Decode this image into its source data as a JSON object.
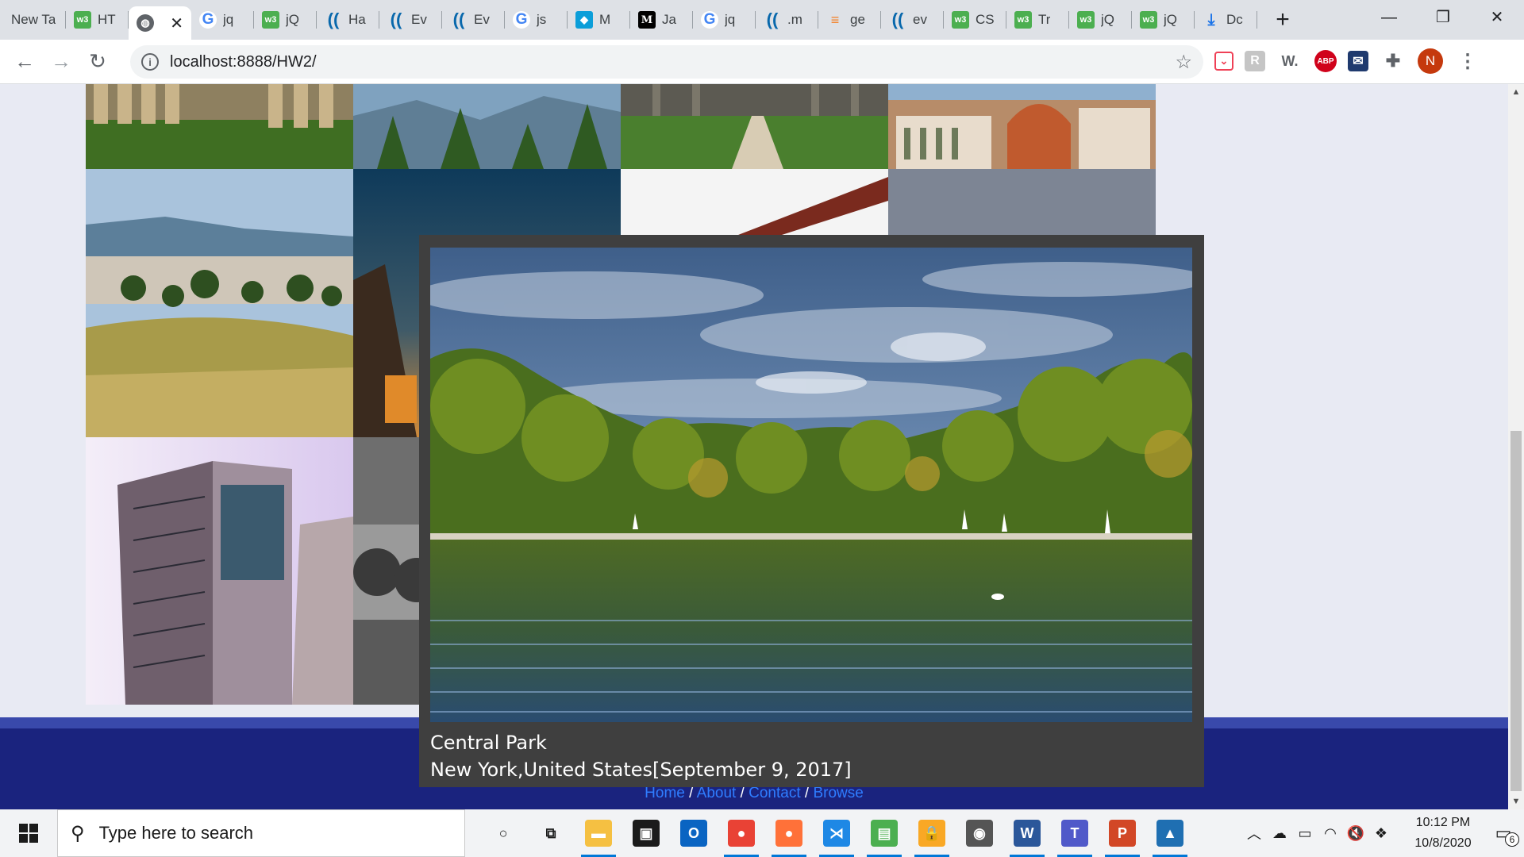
{
  "browser": {
    "tabs": [
      {
        "title": "New Ta",
        "icon": "none"
      },
      {
        "title": "HT",
        "icon": "w3schools-icon"
      },
      {
        "title": "",
        "icon": "globe-icon",
        "active": true
      },
      {
        "title": "jq",
        "icon": "google-icon"
      },
      {
        "title": "jQ",
        "icon": "w3schools-icon"
      },
      {
        "title": "Ha",
        "icon": "jquery-icon"
      },
      {
        "title": "Ev",
        "icon": "jquery-icon"
      },
      {
        "title": "Ev",
        "icon": "jquery-icon"
      },
      {
        "title": "js",
        "icon": "google-icon"
      },
      {
        "title": "M",
        "icon": "mortarboard-icon"
      },
      {
        "title": "Ja",
        "icon": "medium-icon"
      },
      {
        "title": "jq",
        "icon": "google-icon"
      },
      {
        "title": ".m",
        "icon": "jquery-icon"
      },
      {
        "title": "ge",
        "icon": "stackoverflow-icon"
      },
      {
        "title": "ev",
        "icon": "jquery-icon"
      },
      {
        "title": "CS",
        "icon": "w3schools-icon"
      },
      {
        "title": "Tr",
        "icon": "w3schools-icon"
      },
      {
        "title": "jQ",
        "icon": "w3schools-icon"
      },
      {
        "title": "jQ",
        "icon": "w3schools-icon"
      },
      {
        "title": "Dc",
        "icon": "download-icon"
      }
    ],
    "url": "localhost:8888/HW2/",
    "profile_initial": "N",
    "extensions": [
      "pocket-icon",
      "r-extension-icon",
      "w-extension-icon",
      "adblock-plus-icon",
      "mail-extension-icon",
      "extensions-puzzle-icon"
    ]
  },
  "page": {
    "footer_links": {
      "home": "Home",
      "about": "About",
      "contact": "Contact",
      "browse": "Browse",
      "separator": " / "
    }
  },
  "lightbox": {
    "title": "Central Park",
    "detail": "New York,United States[September 9, 2017]"
  },
  "taskbar": {
    "search_placeholder": "Type here to search",
    "time": "10:12 PM",
    "date": "10/8/2020",
    "notification_count": "6",
    "apps": [
      {
        "name": "cortana-icon",
        "glyph": "○",
        "color": "#1b1b1b"
      },
      {
        "name": "task-view-icon",
        "glyph": "⧉",
        "color": "#1b1b1b"
      },
      {
        "name": "file-explorer-icon",
        "glyph": "▬",
        "color": "#f5c042"
      },
      {
        "name": "store-icon",
        "glyph": "▣",
        "color": "#1b1b1b"
      },
      {
        "name": "outlook-icon",
        "glyph": "O",
        "color": "#0a64c2"
      },
      {
        "name": "chrome-icon",
        "glyph": "●",
        "color": "#e94235"
      },
      {
        "name": "firefox-icon",
        "glyph": "●",
        "color": "#ff7139"
      },
      {
        "name": "vscode-icon",
        "glyph": "⋊",
        "color": "#1e88e5"
      },
      {
        "name": "notepad-icon",
        "glyph": "▤",
        "color": "#4caf50"
      },
      {
        "name": "keepass-icon",
        "glyph": "🔒",
        "color": "#f9a825"
      },
      {
        "name": "github-icon",
        "glyph": "◉",
        "color": "#555"
      },
      {
        "name": "word-icon",
        "glyph": "W",
        "color": "#2b579a"
      },
      {
        "name": "teams-icon",
        "glyph": "T",
        "color": "#5059c9"
      },
      {
        "name": "powerpoint-icon",
        "glyph": "P",
        "color": "#d24726"
      },
      {
        "name": "photos-icon",
        "glyph": "▲",
        "color": "#1f6fb2"
      }
    ]
  }
}
